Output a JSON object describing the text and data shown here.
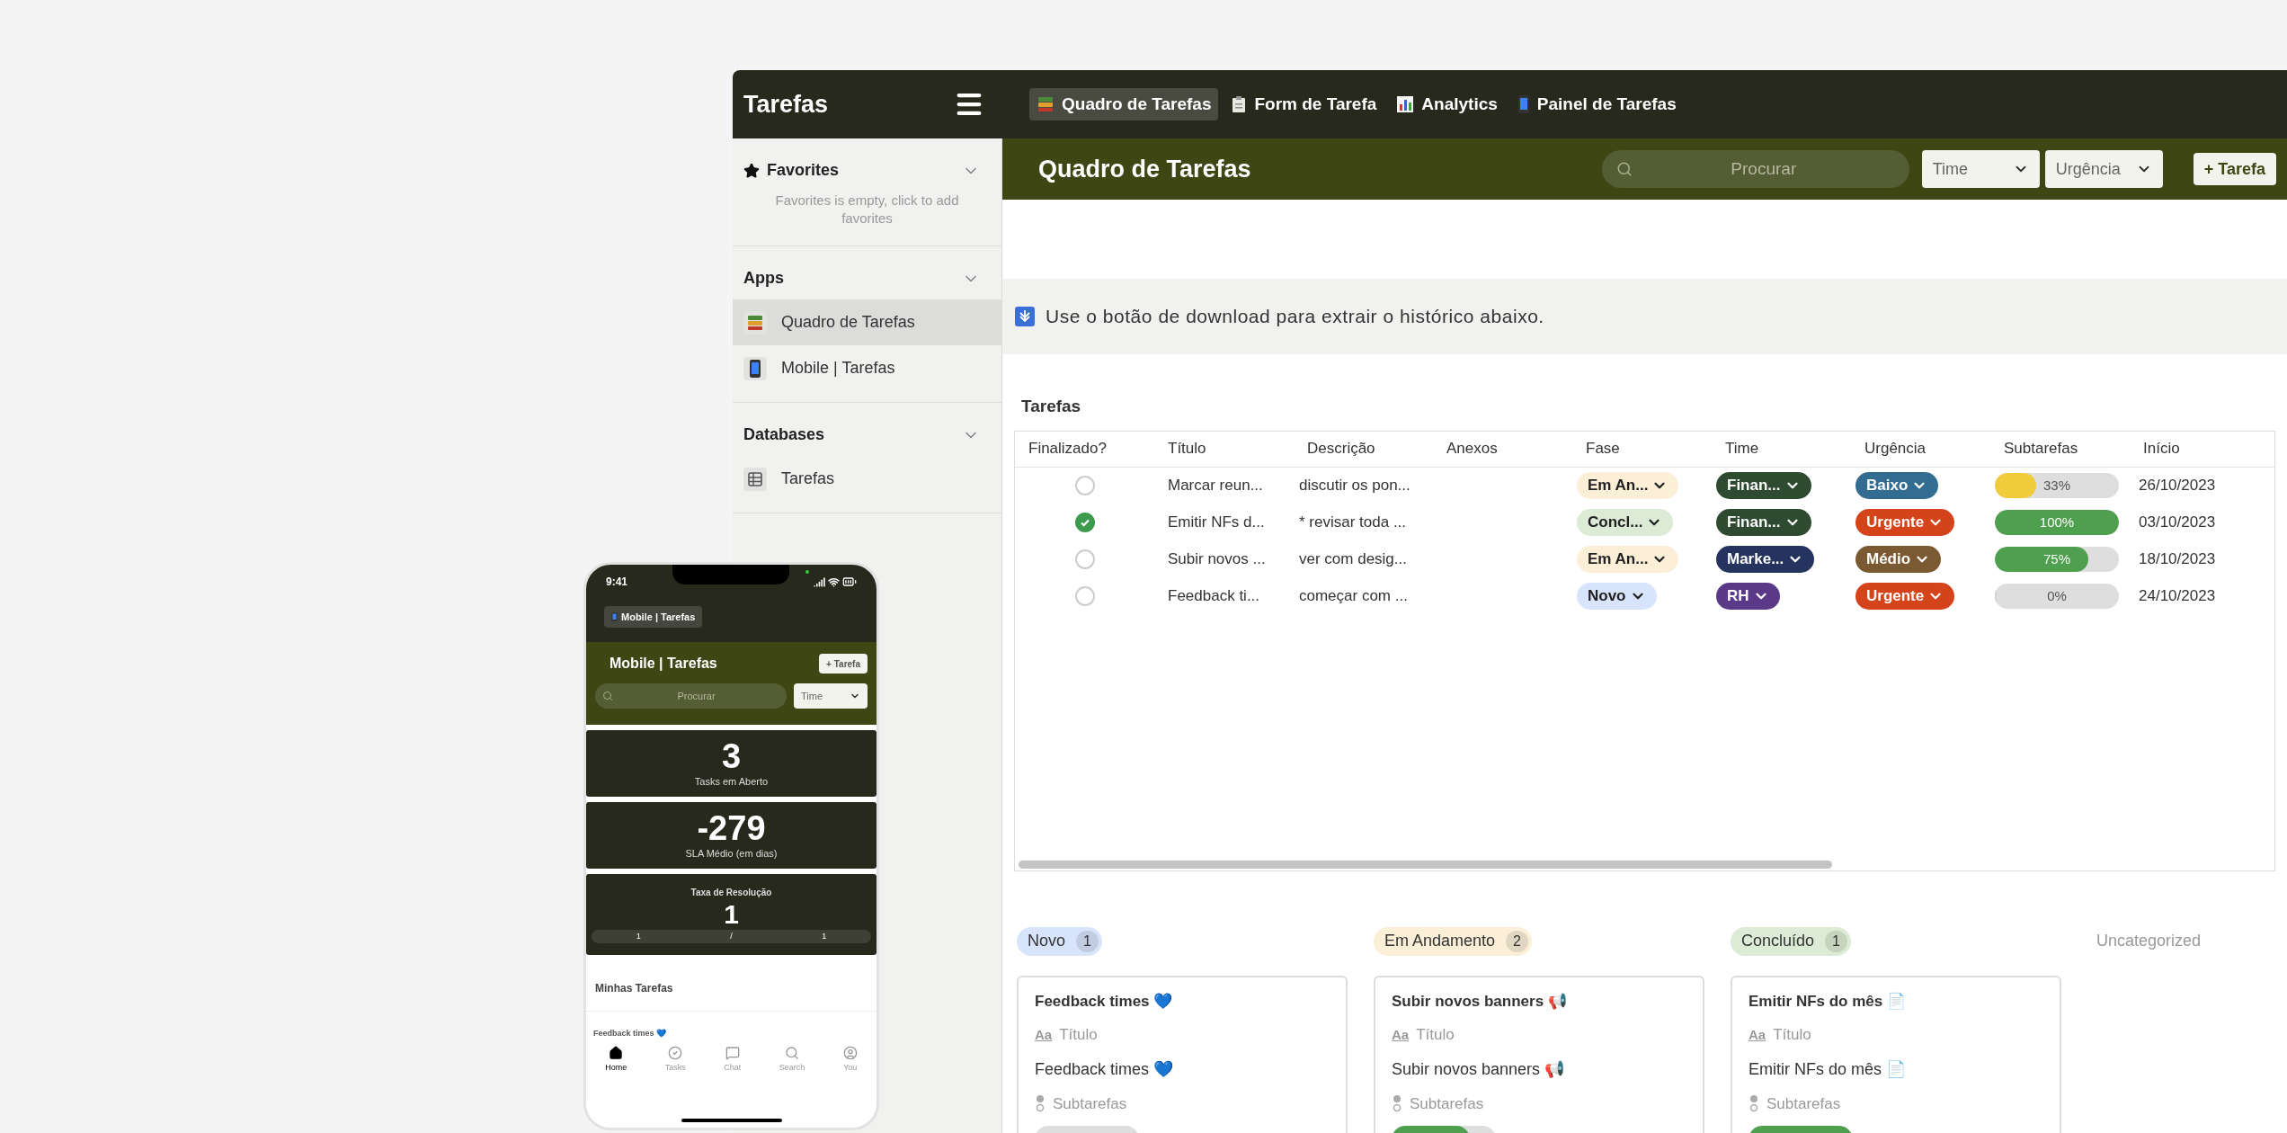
{
  "window": {
    "title": "Tarefas"
  },
  "nav_tabs": [
    {
      "label": "Quadro de Tarefas",
      "selected": true
    },
    {
      "label": "Form de Tarefa",
      "selected": false
    },
    {
      "label": "Analytics",
      "selected": false
    },
    {
      "label": "Painel de Tarefas",
      "selected": false
    }
  ],
  "sidebar": {
    "sections": [
      {
        "title": "Favorites",
        "expanded": true,
        "empty_text": "Favorites is empty, click to add favorites"
      },
      {
        "title": "Apps",
        "expanded": true,
        "items": [
          {
            "label": "Quadro de Tarefas",
            "selected": true
          },
          {
            "label": "Mobile | Tarefas",
            "selected": false
          }
        ]
      },
      {
        "title": "Databases",
        "expanded": true,
        "items": [
          {
            "label": "Tarefas",
            "selected": false
          }
        ]
      }
    ]
  },
  "header": {
    "title": "Quadro de Tarefas",
    "search": {
      "placeholder": "Procurar"
    },
    "filters": [
      "Time",
      "Urgência"
    ],
    "add_button": "+ Tarefa"
  },
  "banner": "Use o botão de download para extrair o histórico abaixo.",
  "table": {
    "title": "Tarefas",
    "columns": [
      "Finalizado?",
      "Título",
      "Descrição",
      "Anexos",
      "Fase",
      "Time",
      "Urgência",
      "Subtarefas",
      "Início"
    ],
    "rows": [
      {
        "done": false,
        "title": "Marcar reun...",
        "description": "discutir os pon...",
        "fase": {
          "label": "Em An...",
          "color": "#fbefd8"
        },
        "time": {
          "label": "Finan...",
          "color": "#2e4a30"
        },
        "urgencia": {
          "label": "Baixo",
          "color": "#326c90"
        },
        "subtarefas": {
          "level": 0.33,
          "reading": "33%",
          "color": "#f1cc3a"
        },
        "inicio": "26/10/2023"
      },
      {
        "done": true,
        "title": "Emitir NFs d...",
        "description": "* revisar toda ...",
        "fase": {
          "label": "Concl...",
          "color": "#dcebd5"
        },
        "time": {
          "label": "Finan...",
          "color": "#2e4a30"
        },
        "urgencia": {
          "label": "Urgente",
          "color": "#d4431a"
        },
        "subtarefas": {
          "level": 1,
          "reading": "100%",
          "color": "#4e9f4e"
        },
        "inicio": "03/10/2023"
      },
      {
        "done": false,
        "title": "Subir novos ...",
        "description": "ver com desig...",
        "fase": {
          "label": "Em An...",
          "color": "#fbefd8"
        },
        "time": {
          "label": "Marke...",
          "color": "#25335f"
        },
        "urgencia": {
          "label": "Médio",
          "color": "#7b5a33"
        },
        "subtarefas": {
          "level": 0.75,
          "reading": "75%",
          "color": "#4e9f4e"
        },
        "inicio": "18/10/2023"
      },
      {
        "done": false,
        "title": "Feedback ti...",
        "description": "começar com ...",
        "fase": {
          "label": "Novo",
          "color": "#d8e4fb"
        },
        "time": {
          "label": "RH",
          "color": "#5a3a88"
        },
        "urgencia": {
          "label": "Urgente",
          "color": "#d4431a"
        },
        "subtarefas": {
          "level": 0,
          "reading": "0%"
        },
        "inicio": "24/10/2023"
      }
    ]
  },
  "board": {
    "columns": [
      {
        "label": "Novo",
        "count": "1",
        "color": "#d8e4fb",
        "cards": [
          {
            "title": "Feedback times 💙",
            "field_icon": "Aa",
            "field_label": "Título",
            "field_value": "Feedback times 💙",
            "subtasks_label": "Subtarefas",
            "level": 0
          }
        ]
      },
      {
        "label": "Em Andamento",
        "count": "2",
        "color": "#fbefd8",
        "cards": [
          {
            "title": "Subir novos banners 📢",
            "field_icon": "Aa",
            "field_label": "Título",
            "field_value": "Subir novos banners 📢",
            "subtasks_label": "Subtarefas",
            "level": 0.75
          }
        ]
      },
      {
        "label": "Concluído",
        "count": "1",
        "color": "#dcebd5",
        "cards": [
          {
            "title": "Emitir NFs do mês 📄",
            "field_icon": "Aa",
            "field_label": "Título",
            "field_value": "Emitir NFs do mês 📄",
            "subtasks_label": "Subtarefas",
            "level": 1
          }
        ]
      },
      {
        "label": "Uncategorized"
      }
    ]
  },
  "phone": {
    "time": "9:41",
    "app_badge": "Mobile | Tarefas",
    "title": "Mobile | Tarefas",
    "add_button": "+ Tarefa",
    "search": {
      "placeholder": "Procurar"
    },
    "filter": "Time",
    "stats": [
      {
        "value": "3",
        "label": "Tasks em Aberto"
      },
      {
        "value": "-279",
        "label": "SLA Médio (em dias)"
      }
    ],
    "resolution": {
      "title": "Taxa de Resolução",
      "value": "1",
      "ratio": [
        "1",
        "/",
        "1"
      ]
    },
    "list_title": "Minhas Tarefas",
    "list_item": "Feedback times 💙",
    "nav": [
      {
        "label": "Home",
        "selected": true
      },
      {
        "label": "Tasks",
        "selected": false
      },
      {
        "label": "Chat",
        "selected": false
      },
      {
        "label": "Search",
        "selected": false
      },
      {
        "label": "You",
        "selected": false
      }
    ]
  }
}
